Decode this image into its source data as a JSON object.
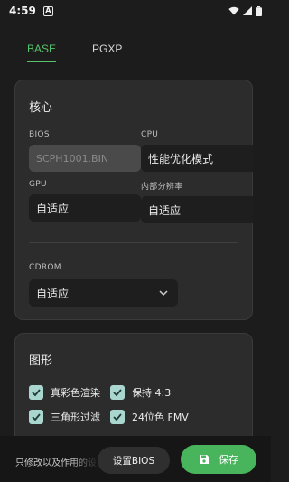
{
  "status_bar": {
    "time": "4:59",
    "notification_icon": "A",
    "icons": [
      "wifi-icon",
      "signal-icon",
      "battery-icon"
    ]
  },
  "tabs": [
    {
      "label": "BASE",
      "active": true
    },
    {
      "label": "PGXP",
      "active": false
    }
  ],
  "core": {
    "title": "核心",
    "bios": {
      "label": "BIOS",
      "value": "SCPH1001.BIN",
      "disabled": true
    },
    "cpu": {
      "label": "CPU",
      "value": "性能优化模式"
    },
    "gpu": {
      "label": "GPU",
      "value": "自适应"
    },
    "internal_resolution": {
      "label": "内部分辨率",
      "value": "自适应"
    },
    "cdrom": {
      "label": "CDROM",
      "value": "自适应"
    }
  },
  "graphics": {
    "title": "图形",
    "options": [
      {
        "label": "真彩色渲染",
        "checked": true
      },
      {
        "label": "保持 4:3",
        "checked": true
      },
      {
        "label": "三角形过滤",
        "checked": true
      },
      {
        "label": "24位色 FMV",
        "checked": true
      }
    ]
  },
  "bottom": {
    "hint": "只修改以及作用的设",
    "set_bios_label": "设置BIOS",
    "save_label": "保存"
  },
  "colors": {
    "accent": "#57c16a",
    "save_button": "#48b45c",
    "checkbox": "#a9d6cf",
    "card": "#2c2c2c",
    "background": "#1c1c1c"
  }
}
